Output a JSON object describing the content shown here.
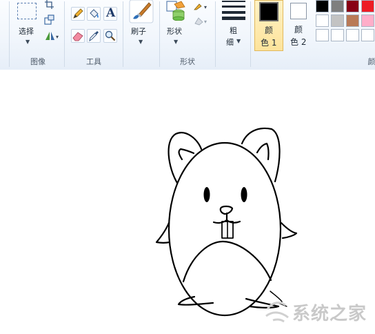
{
  "ribbon": {
    "image_group": {
      "select_label": "选择",
      "group_label": "图像"
    },
    "tools_group": {
      "text_tool_glyph": "A",
      "group_label": "工具"
    },
    "brushes": {
      "label": "刷子"
    },
    "shapes_group": {
      "label": "形状",
      "group_label": "形状"
    },
    "size": {
      "label_line1": "粗",
      "label_line2": "细"
    },
    "color1": {
      "label_line1": "颜",
      "label_line2": "色 1",
      "value": "#000000"
    },
    "color2": {
      "label_line1": "颜",
      "label_line2": "色 2",
      "value": "#ffffff"
    },
    "palette": [
      "#000000",
      "#7f7f7f",
      "#880015",
      "#ed1c24",
      "#ffffff",
      "#c3c3c3",
      "#b97a57",
      "#ffaec9",
      "#ffffff",
      "#ffffff",
      "#ffffff",
      "#ffffff"
    ]
  },
  "watermark": {
    "text": "系统之家"
  }
}
